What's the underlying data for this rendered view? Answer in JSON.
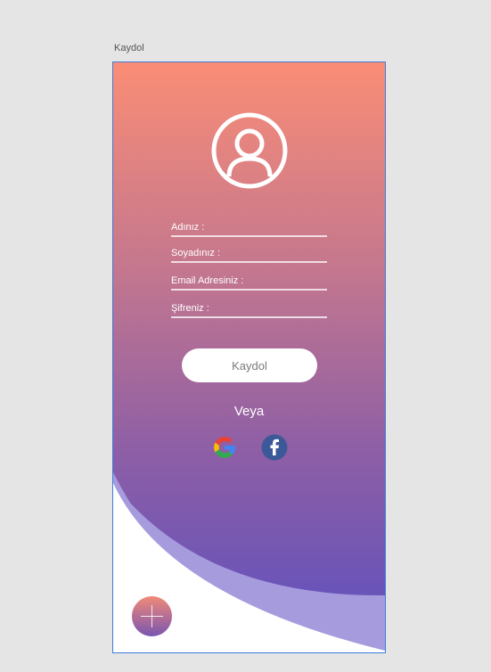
{
  "artboard": {
    "title": "Kaydol"
  },
  "form": {
    "fields": [
      {
        "label": "Adınız :"
      },
      {
        "label": "Soyadınız :"
      },
      {
        "label": "Email Adresiniz :"
      },
      {
        "label": "Şifreniz :"
      }
    ],
    "submit_label": "Kaydol",
    "separator": "Veya"
  },
  "social": [
    "google-icon",
    "facebook-icon"
  ],
  "colors": {
    "gradient_top": "#fa8d76",
    "gradient_bottom": "#5b4fc0",
    "wave_light": "#a69cdd",
    "facebook_blue": "#3b5998",
    "selection_border": "#3b7ddd"
  }
}
